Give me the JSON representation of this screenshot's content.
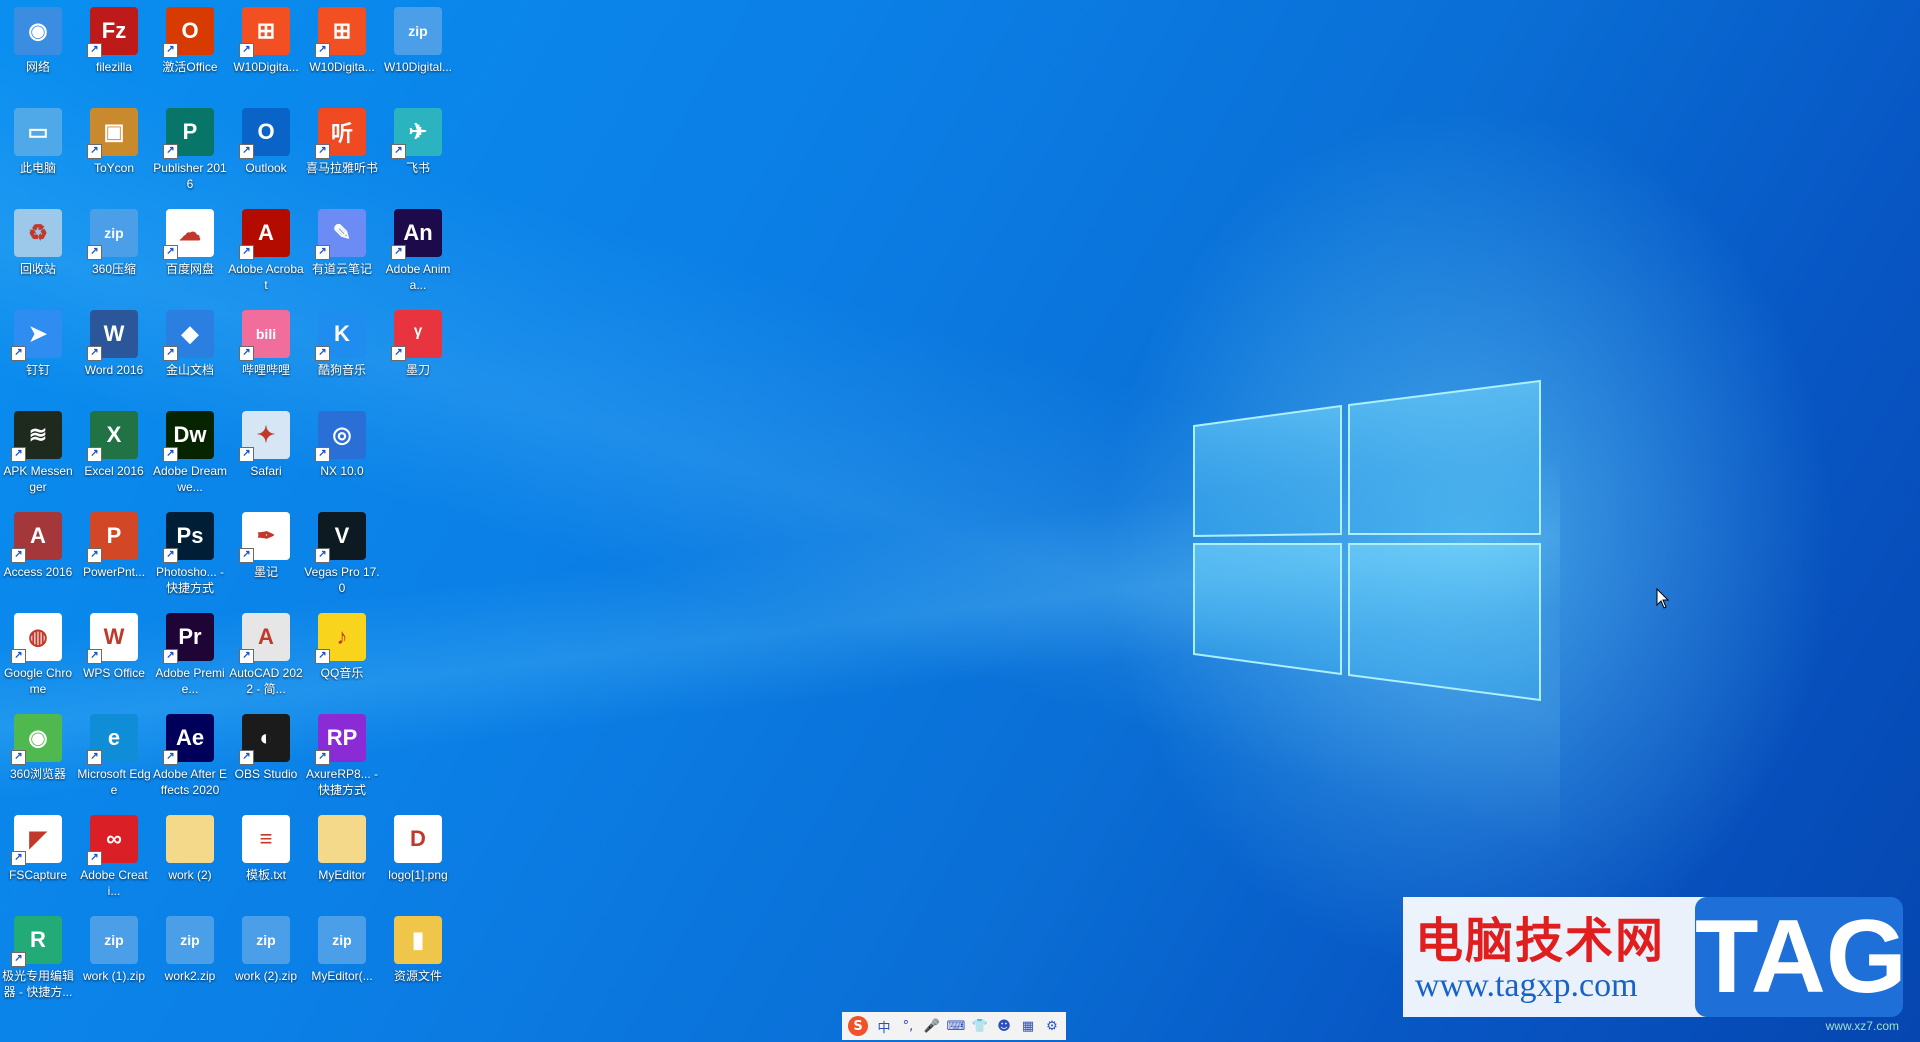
{
  "desktop_icons": [
    {
      "label": "网络",
      "icon": "network-icon",
      "bg": "#3a8de0",
      "glyph": "◉",
      "shortcut": false
    },
    {
      "label": "filezilla",
      "icon": "filezilla-icon",
      "bg": "#bf1a1a",
      "glyph": "Fz",
      "shortcut": true
    },
    {
      "label": "激活Office",
      "icon": "office-activate-icon",
      "bg": "#d83b01",
      "glyph": "O",
      "shortcut": true
    },
    {
      "label": "W10Digita...",
      "icon": "windows-shield-icon",
      "bg": "#f25022",
      "glyph": "⊞",
      "shortcut": true
    },
    {
      "label": "W10Digita...",
      "icon": "windows-shield-icon",
      "bg": "#f25022",
      "glyph": "⊞",
      "shortcut": true
    },
    {
      "label": "W10Digital...",
      "icon": "zip-archive-icon",
      "bg": "#4a9fe8",
      "glyph": "zip",
      "shortcut": false
    },
    {
      "label": "此电脑",
      "icon": "this-pc-icon",
      "bg": "#4fa8e8",
      "glyph": "▭",
      "shortcut": false
    },
    {
      "label": "ToYcon",
      "icon": "toycon-icon",
      "bg": "#c98a2e",
      "glyph": "▣",
      "shortcut": true
    },
    {
      "label": "Publisher 2016",
      "icon": "publisher-icon",
      "bg": "#077568",
      "glyph": "P",
      "shortcut": true
    },
    {
      "label": "Outlook",
      "icon": "outlook-icon",
      "bg": "#0a64c8",
      "glyph": "O",
      "shortcut": true
    },
    {
      "label": "喜马拉雅听书",
      "icon": "ximalaya-icon",
      "bg": "#f04a23",
      "glyph": "听",
      "shortcut": true
    },
    {
      "label": "飞书",
      "icon": "feishu-icon",
      "bg": "#2bb3c0",
      "glyph": "✈",
      "shortcut": true
    },
    {
      "label": "回收站",
      "icon": "recycle-bin-icon",
      "bg": "#9cc8ea",
      "glyph": "♻",
      "shortcut": false
    },
    {
      "label": "360压缩",
      "icon": "zip-archive-icon",
      "bg": "#4a9fe8",
      "glyph": "zip",
      "shortcut": true
    },
    {
      "label": "百度网盘",
      "icon": "baidu-netdisk-icon",
      "bg": "#ffffff",
      "glyph": "☁",
      "shortcut": true
    },
    {
      "label": "Adobe Acrobat",
      "icon": "acrobat-icon",
      "bg": "#b30b00",
      "glyph": "A",
      "shortcut": true
    },
    {
      "label": "有道云笔记",
      "icon": "youdao-note-icon",
      "bg": "#6b8cf5",
      "glyph": "✎",
      "shortcut": true
    },
    {
      "label": "Adobe Anima...",
      "icon": "animate-icon",
      "bg": "#1d0a4a",
      "glyph": "An",
      "shortcut": true
    },
    {
      "label": "钉钉",
      "icon": "dingtalk-icon",
      "bg": "#2f8cf0",
      "glyph": "➤",
      "shortcut": true
    },
    {
      "label": "Word 2016",
      "icon": "word-icon",
      "bg": "#2b579a",
      "glyph": "W",
      "shortcut": true
    },
    {
      "label": "金山文档",
      "icon": "kingsoft-docs-icon",
      "bg": "#2a7fe0",
      "glyph": "◆",
      "shortcut": true
    },
    {
      "label": "哔哩哔哩",
      "icon": "bilibili-icon",
      "bg": "#f16d9b",
      "glyph": "bili",
      "shortcut": true
    },
    {
      "label": "酷狗音乐",
      "icon": "kugou-icon",
      "bg": "#1f8cf0",
      "glyph": "K",
      "shortcut": true
    },
    {
      "label": "墨刀",
      "icon": "modao-icon",
      "bg": "#e8343e",
      "glyph": "ᵞ",
      "shortcut": true
    },
    {
      "label": "APK Messenger",
      "icon": "apk-messenger-icon",
      "bg": "#1d2a1d",
      "glyph": "≋",
      "shortcut": true
    },
    {
      "label": "Excel 2016",
      "icon": "excel-icon",
      "bg": "#217346",
      "glyph": "X",
      "shortcut": true
    },
    {
      "label": "Adobe Dreamwe...",
      "icon": "dreamweaver-icon",
      "bg": "#072401",
      "glyph": "Dw",
      "shortcut": true
    },
    {
      "label": "Safari",
      "icon": "safari-icon",
      "bg": "#d6e6f4",
      "glyph": "✦",
      "shortcut": true
    },
    {
      "label": "NX 10.0",
      "icon": "nx-icon",
      "bg": "#2a6fd6",
      "glyph": "◎",
      "shortcut": true
    },
    {
      "label": "Access 2016",
      "icon": "access-icon",
      "bg": "#a4373a",
      "glyph": "A",
      "shortcut": true
    },
    {
      "label": "PowerPnt...",
      "icon": "powerpoint-icon",
      "bg": "#d24726",
      "glyph": "P",
      "shortcut": true
    },
    {
      "label": "Photosho... - 快捷方式",
      "icon": "photoshop-icon",
      "bg": "#001e36",
      "glyph": "Ps",
      "shortcut": true
    },
    {
      "label": "墨记",
      "icon": "moji-icon",
      "bg": "#ffffff",
      "glyph": "✒",
      "shortcut": true
    },
    {
      "label": "Vegas Pro 17.0",
      "icon": "vegas-icon",
      "bg": "#0d1a22",
      "glyph": "V",
      "shortcut": true
    },
    {
      "label": "Google Chrome",
      "icon": "chrome-icon",
      "bg": "#ffffff",
      "glyph": "◍",
      "shortcut": true
    },
    {
      "label": "WPS Office",
      "icon": "wps-icon",
      "bg": "#ffffff",
      "glyph": "W",
      "shortcut": true
    },
    {
      "label": "Adobe Premie...",
      "icon": "premiere-icon",
      "bg": "#1f0536",
      "glyph": "Pr",
      "shortcut": true
    },
    {
      "label": "AutoCAD 2022 - 简...",
      "icon": "autocad-icon",
      "bg": "#e6e6e6",
      "glyph": "A",
      "shortcut": true
    },
    {
      "label": "QQ音乐",
      "icon": "qq-music-icon",
      "bg": "#f8d51c",
      "glyph": "♪",
      "shortcut": true
    },
    {
      "label": "360浏览器",
      "icon": "360-browser-icon",
      "bg": "#4fb84f",
      "glyph": "◉",
      "shortcut": true
    },
    {
      "label": "Microsoft Edge",
      "icon": "edge-icon",
      "bg": "#0f8dd6",
      "glyph": "e",
      "shortcut": true
    },
    {
      "label": "Adobe After Effects 2020",
      "icon": "after-effects-icon",
      "bg": "#00005b",
      "glyph": "Ae",
      "shortcut": true
    },
    {
      "label": "OBS Studio",
      "icon": "obs-icon",
      "bg": "#1b1b1b",
      "glyph": "◐",
      "shortcut": true
    },
    {
      "label": "AxureRP8... - 快捷方式",
      "icon": "axure-icon",
      "bg": "#8a2bd6",
      "glyph": "RP",
      "shortcut": true
    },
    {
      "label": "FSCapture",
      "icon": "fscapture-icon",
      "bg": "#ffffff",
      "glyph": "◤",
      "shortcut": true
    },
    {
      "label": "Adobe Creati...",
      "icon": "creative-cloud-icon",
      "bg": "#da1f26",
      "glyph": "∞",
      "shortcut": true
    },
    {
      "label": "work (2)",
      "icon": "folder-icon",
      "bg": "#f4d98a",
      "glyph": "",
      "shortcut": false
    },
    {
      "label": "模板.txt",
      "icon": "text-file-icon",
      "bg": "#ffffff",
      "glyph": "≡",
      "shortcut": false
    },
    {
      "label": "MyEditor",
      "icon": "folder-icon",
      "bg": "#f4d98a",
      "glyph": "",
      "shortcut": false
    },
    {
      "label": "logo[1].png",
      "icon": "image-file-icon",
      "bg": "#ffffff",
      "glyph": "D",
      "shortcut": false
    },
    {
      "label": "极光专用编辑器 - 快捷方...",
      "icon": "jiguang-editor-icon",
      "bg": "#22aa77",
      "glyph": "R",
      "shortcut": true
    },
    {
      "label": "work (1).zip",
      "icon": "zip-archive-icon",
      "bg": "#4a9fe8",
      "glyph": "zip",
      "shortcut": false
    },
    {
      "label": "work2.zip",
      "icon": "zip-archive-icon",
      "bg": "#4a9fe8",
      "glyph": "zip",
      "shortcut": false
    },
    {
      "label": "work (2).zip",
      "icon": "zip-archive-icon",
      "bg": "#4a9fe8",
      "glyph": "zip",
      "shortcut": false
    },
    {
      "label": "MyEditor(...",
      "icon": "zip-archive-icon",
      "bg": "#4a9fe8",
      "glyph": "zip",
      "shortcut": false
    },
    {
      "label": "资源文件",
      "icon": "folder-icon",
      "bg": "#f0c64a",
      "glyph": "▮",
      "shortcut": false
    }
  ],
  "watermark": {
    "title": "电脑技术网",
    "url": "www.tagxp.com",
    "tag": "TAG",
    "small": "www.xz7.com"
  },
  "ime_bar": {
    "logo": "S",
    "items": [
      {
        "name": "ime-chinese-mode",
        "glyph": "中"
      },
      {
        "name": "ime-punctuation-icon",
        "glyph": "°,"
      },
      {
        "name": "ime-microphone-icon",
        "glyph": "🎤"
      },
      {
        "name": "ime-keyboard-icon",
        "glyph": "⌨"
      },
      {
        "name": "ime-skin-icon",
        "glyph": "👕"
      },
      {
        "name": "ime-robot-icon",
        "glyph": "☻"
      },
      {
        "name": "ime-toolbox-icon",
        "glyph": "▦"
      },
      {
        "name": "ime-settings-icon",
        "glyph": "⚙"
      }
    ]
  },
  "colors": {
    "accent": "#0a7fe6",
    "text": "#ffffff"
  }
}
